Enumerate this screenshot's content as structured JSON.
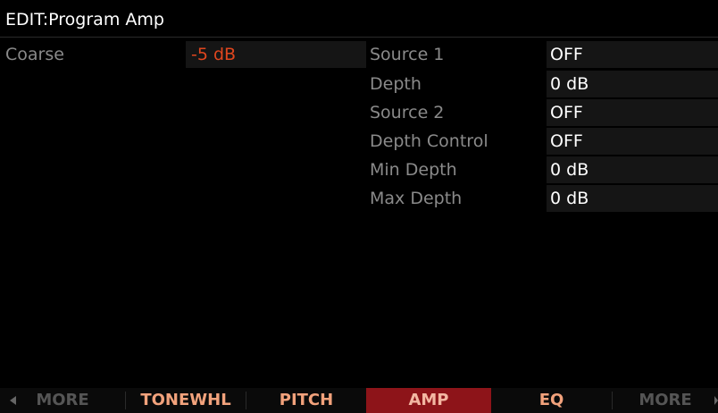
{
  "header": {
    "title": "EDIT:Program Amp"
  },
  "left_params": [
    {
      "label": "Coarse",
      "value": "-5 dB"
    }
  ],
  "right_params": [
    {
      "label": "Source 1",
      "value": "OFF"
    },
    {
      "label": "Depth",
      "value": "0 dB"
    },
    {
      "label": "Source 2",
      "value": "OFF"
    },
    {
      "label": "Depth Control",
      "value": "OFF"
    },
    {
      "label": "Min Depth",
      "value": "0 dB"
    },
    {
      "label": "Max Depth",
      "value": "0 dB"
    }
  ],
  "softkeys": [
    {
      "label": "MORE",
      "icon": "arrow-left-icon"
    },
    {
      "label": "TONEWHL"
    },
    {
      "label": "PITCH"
    },
    {
      "label": "AMP",
      "selected": true
    },
    {
      "label": "EQ"
    },
    {
      "label": "MORE",
      "icon": "arrow-right-icon"
    }
  ],
  "colors": {
    "background": "#000000",
    "label": "#8a8a8a",
    "value": "#ffffff",
    "active_value": "#e0461e",
    "field_bg": "#151515",
    "softkey_text": "#f2a27c",
    "softkey_selected_bg": "#8d1419"
  }
}
